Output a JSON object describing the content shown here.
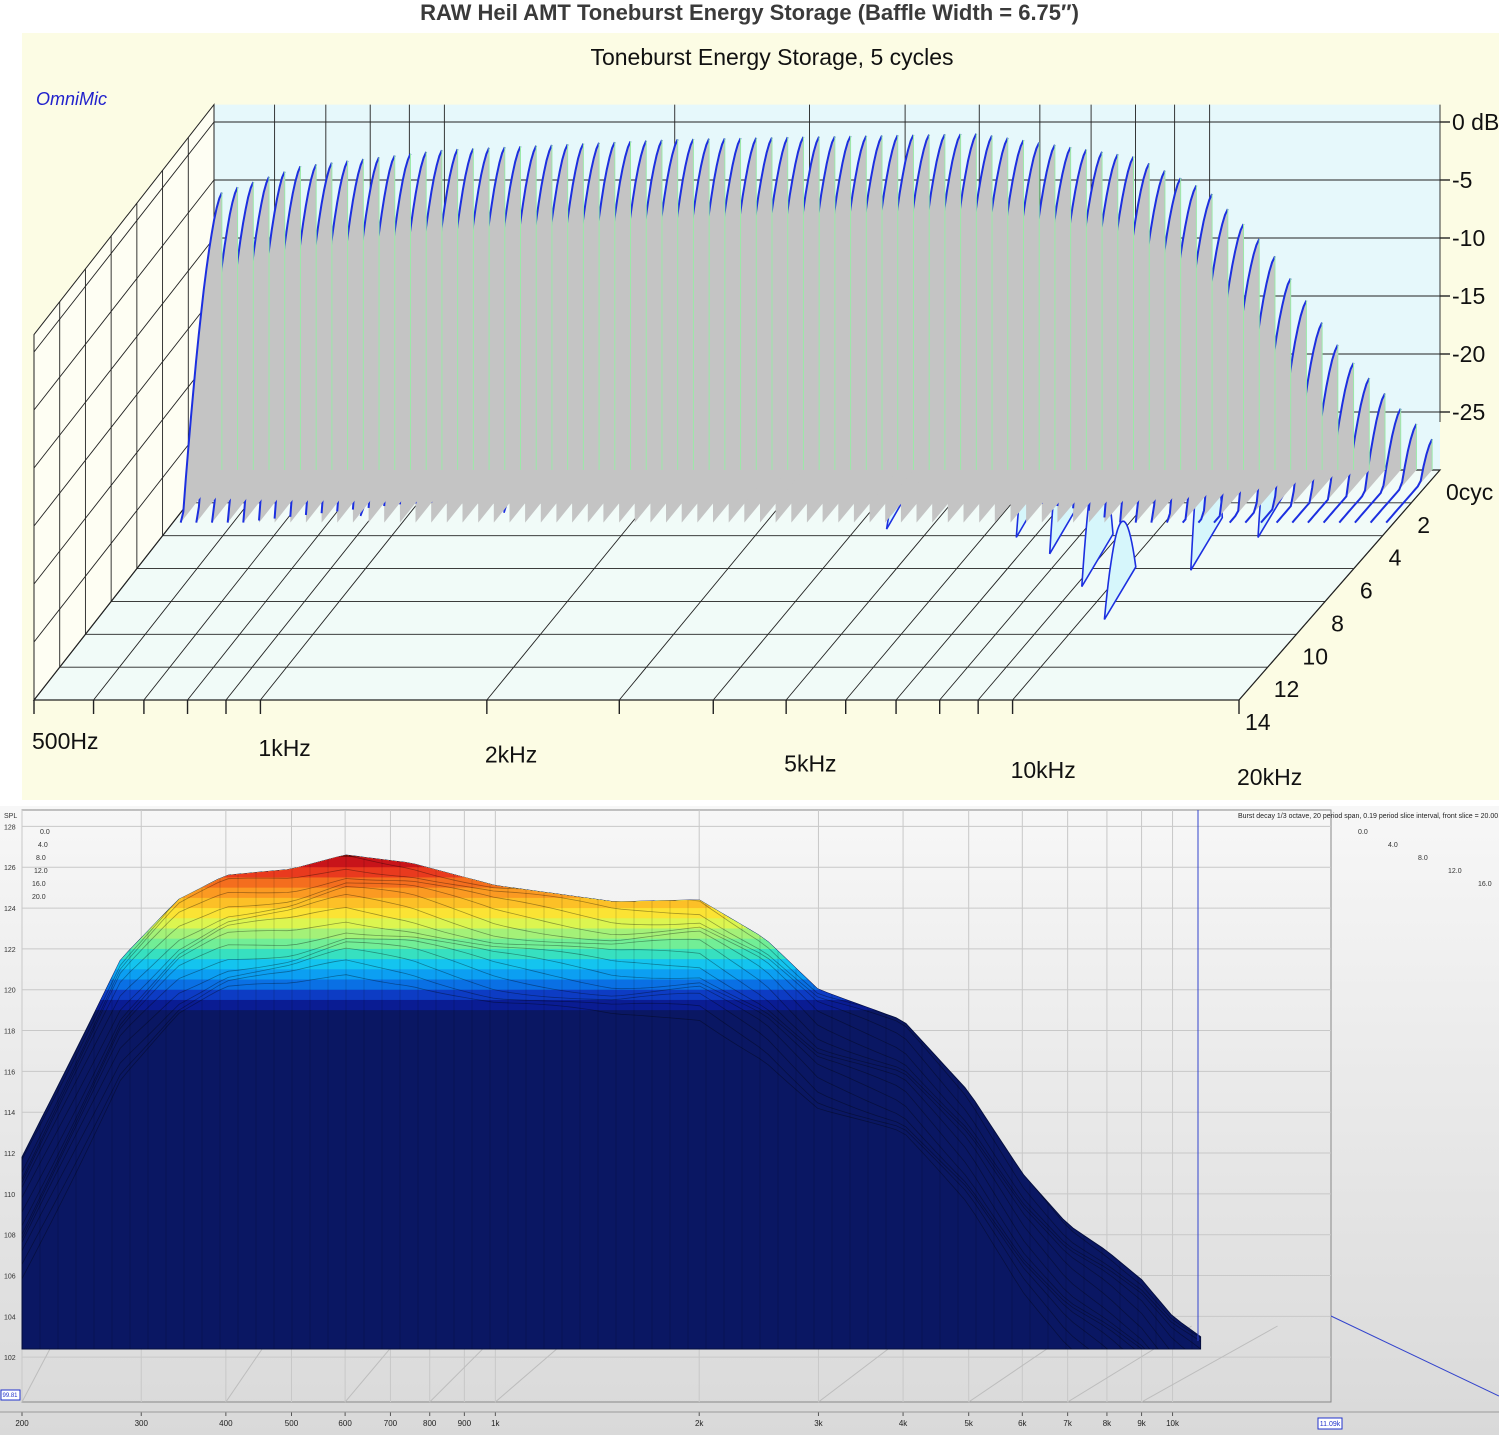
{
  "page_title": "RAW Heil AMT Toneburst Energy Storage (Baffle Width = 6.75″)",
  "chart_data": [
    {
      "type": "waterfall",
      "title": "Toneburst Energy Storage, 5 cycles",
      "watermark": "OmniMic",
      "x_scale": "log",
      "xlim": [
        500,
        20000
      ],
      "x_ticks": [
        {
          "label": "500Hz",
          "value": 500
        },
        {
          "label": "1kHz",
          "value": 1000
        },
        {
          "label": "2kHz",
          "value": 2000
        },
        {
          "label": "5kHz",
          "value": 5000
        },
        {
          "label": "10kHz",
          "value": 10000
        },
        {
          "label": "20kHz",
          "value": 20000
        }
      ],
      "y_ticks": [
        {
          "label": "0 dB",
          "value": 0
        },
        {
          "label": "-5",
          "value": -5
        },
        {
          "label": "-10",
          "value": -10
        },
        {
          "label": "-15",
          "value": -15
        },
        {
          "label": "-20",
          "value": -20
        },
        {
          "label": "-25",
          "value": -25
        }
      ],
      "ylim": [
        -30,
        0
      ],
      "z_ticks": [
        {
          "label": "0cyc",
          "value": 0
        },
        {
          "label": "2",
          "value": 2
        },
        {
          "label": "4",
          "value": 4
        },
        {
          "label": "6",
          "value": 6
        },
        {
          "label": "8",
          "value": 8
        },
        {
          "label": "10",
          "value": 10
        },
        {
          "label": "12",
          "value": 12
        },
        {
          "label": "14",
          "value": 14
        }
      ],
      "zlim": [
        0,
        14
      ],
      "num_slices": 78,
      "level_profile_db": [
        {
          "freq": 500,
          "db": -6.3
        },
        {
          "freq": 650,
          "db": -3.8
        },
        {
          "freq": 1000,
          "db": -2.4
        },
        {
          "freq": 2000,
          "db": -1.5
        },
        {
          "freq": 5000,
          "db": -1.0
        },
        {
          "freq": 8000,
          "db": -3.0
        },
        {
          "freq": 10000,
          "db": -6.0
        },
        {
          "freq": 12000,
          "db": -11.0
        },
        {
          "freq": 15000,
          "db": -20.0
        },
        {
          "freq": 20000,
          "db": -28.0
        }
      ],
      "decay_ridges": [
        {
          "freq": 720,
          "peak_cycles": 0.8,
          "level_db": -28
        },
        {
          "freq": 850,
          "peak_cycles": 1.2,
          "level_db": -27
        },
        {
          "freq": 1150,
          "peak_cycles": 0.9,
          "level_db": -26
        },
        {
          "freq": 1300,
          "peak_cycles": 1.0,
          "level_db": -27
        },
        {
          "freq": 3800,
          "peak_cycles": 1.3,
          "level_db": -29
        },
        {
          "freq": 4300,
          "peak_cycles": 2.0,
          "level_db": -27
        },
        {
          "freq": 6500,
          "peak_cycles": 2.5,
          "level_db": -22
        },
        {
          "freq": 7500,
          "peak_cycles": 3.5,
          "level_db": -20
        },
        {
          "freq": 9000,
          "peak_cycles": 5.5,
          "level_db": -21
        },
        {
          "freq": 10500,
          "peak_cycles": 7.5,
          "level_db": -24
        },
        {
          "freq": 12000,
          "peak_cycles": 4.5,
          "level_db": -18
        },
        {
          "freq": 13500,
          "peak_cycles": 2.5,
          "level_db": -20
        }
      ],
      "colors": {
        "background": "#fcfce4",
        "back_wall": "#e6f8fb",
        "floor": "#f1fbf8",
        "slice_fill": "#c4c4c4",
        "ridge_fill": "#d6f6fb",
        "trace": "#1c2fe0",
        "grid": "#222222"
      }
    },
    {
      "type": "surface",
      "info_text": "Burst decay 1/3 octave, 20 period span, 0.19 period slice interval,  front slice = 20.00 p",
      "y_axis_name": "SPL",
      "x_scale": "log",
      "xlim": [
        200,
        20000
      ],
      "x_tick_labels": [
        "200",
        "300",
        "400",
        "500",
        "600",
        "700",
        "800",
        "900",
        "1k",
        "2k",
        "3k",
        "4k",
        "5k",
        "6k",
        "7k",
        "8k",
        "9k",
        "10k"
      ],
      "x_tick_values": [
        200,
        300,
        400,
        500,
        600,
        700,
        800,
        900,
        1000,
        2000,
        3000,
        4000,
        5000,
        6000,
        7000,
        8000,
        9000,
        10000
      ],
      "cursor_readout": "11.09k",
      "y_readout": "99.81",
      "y_ticks": [
        128,
        126,
        124,
        122,
        120,
        118,
        116,
        114,
        112,
        110,
        108,
        106,
        104,
        102
      ],
      "ylim": [
        100,
        129
      ],
      "depth_labels_left": [
        "0.0",
        "4.0",
        "8.0",
        "12.0",
        "16.0",
        "20.0"
      ],
      "depth_labels_right": [
        "0.0",
        "4.0",
        "8.0",
        "12.0",
        "16.0"
      ],
      "top_profile_spl": [
        {
          "freq": 200,
          "spl": 111.8
        },
        {
          "freq": 240,
          "spl": 117.0
        },
        {
          "freq": 280,
          "spl": 121.5
        },
        {
          "freq": 340,
          "spl": 124.4
        },
        {
          "freq": 400,
          "spl": 125.6
        },
        {
          "freq": 500,
          "spl": 125.9
        },
        {
          "freq": 600,
          "spl": 126.6
        },
        {
          "freq": 750,
          "spl": 126.2
        },
        {
          "freq": 1000,
          "spl": 125.1
        },
        {
          "freq": 1500,
          "spl": 124.3
        },
        {
          "freq": 2000,
          "spl": 124.4
        },
        {
          "freq": 2500,
          "spl": 122.5
        },
        {
          "freq": 3000,
          "spl": 120.0
        },
        {
          "freq": 4000,
          "spl": 118.5
        },
        {
          "freq": 5000,
          "spl": 115.0
        },
        {
          "freq": 6000,
          "spl": 111.0
        },
        {
          "freq": 7000,
          "spl": 108.5
        },
        {
          "freq": 8000,
          "spl": 107.2
        },
        {
          "freq": 9000,
          "spl": 105.8
        },
        {
          "freq": 10000,
          "spl": 104.0
        },
        {
          "freq": 11000,
          "spl": 103.0
        }
      ],
      "color_bands": [
        {
          "spl": 126.5,
          "color": "#8b0e0e"
        },
        {
          "spl": 126.0,
          "color": "#c8141a"
        },
        {
          "spl": 125.5,
          "color": "#e93a1e"
        },
        {
          "spl": 125.0,
          "color": "#f46e1e"
        },
        {
          "spl": 124.5,
          "color": "#fb9a22"
        },
        {
          "spl": 124.0,
          "color": "#fcc027"
        },
        {
          "spl": 123.5,
          "color": "#fbe334"
        },
        {
          "spl": 123.0,
          "color": "#dcf550"
        },
        {
          "spl": 122.5,
          "color": "#a4f178"
        },
        {
          "spl": 122.0,
          "color": "#72ee96"
        },
        {
          "spl": 121.5,
          "color": "#37e0c0"
        },
        {
          "spl": 121.0,
          "color": "#14c4ef"
        },
        {
          "spl": 120.5,
          "color": "#0c9ff2"
        },
        {
          "spl": 120.0,
          "color": "#0a70e4"
        },
        {
          "spl": 119.5,
          "color": "#0d3cc4"
        },
        {
          "spl": 119.0,
          "color": "#0a1c93"
        }
      ],
      "base_color": "#0a1763"
    }
  ]
}
